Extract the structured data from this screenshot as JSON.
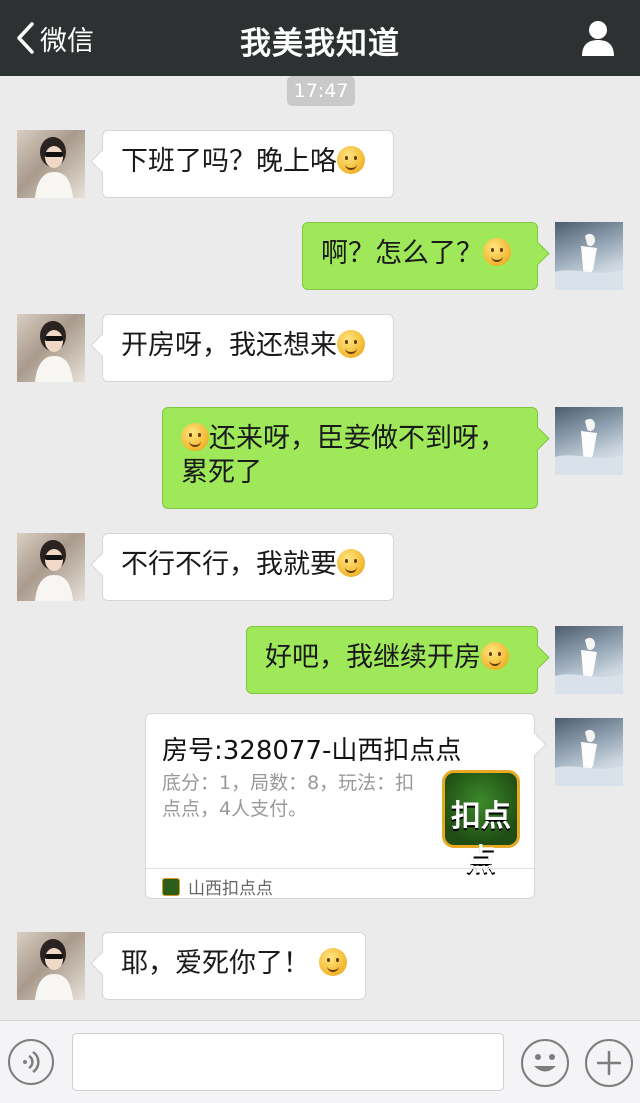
{
  "nav": {
    "back_label": "微信",
    "title": "我美我知道",
    "user_icon": "person-icon"
  },
  "timestamp": "17:47",
  "messages": [
    {
      "from": "them",
      "text": "下班了吗？晚上咯",
      "emoji": "covering-mouth-emoji"
    },
    {
      "from": "me",
      "text": "啊？怎么了？",
      "emoji": "dizzy-face-emoji"
    },
    {
      "from": "them",
      "text": "开房呀，我还想来",
      "emoji": "smirk-emoji"
    },
    {
      "from": "me",
      "text_line1": "还来呀，臣妾做不到呀，",
      "text_line2": "累死了",
      "emoji": "tired-face-emoji"
    },
    {
      "from": "them",
      "text": "不行不行，我就要",
      "emoji": "pleading-emoji"
    },
    {
      "from": "me",
      "text": "好吧，我继续开房",
      "emoji": "ninja-face-emoji"
    },
    {
      "from": "them",
      "text": "耶，爱死你了！",
      "emoji": "heart-eyes-emoji"
    }
  ],
  "card": {
    "title": "房号:328077-山西扣点点",
    "description": "底分：1，局数：8，玩法：扣点点，4人支付。",
    "icon_text": "扣点点",
    "source": "山西扣点点"
  },
  "input_bar": {
    "voice_icon": "voice-icon",
    "emoji_icon": "smiley-icon",
    "plus_icon": "plus-icon"
  }
}
